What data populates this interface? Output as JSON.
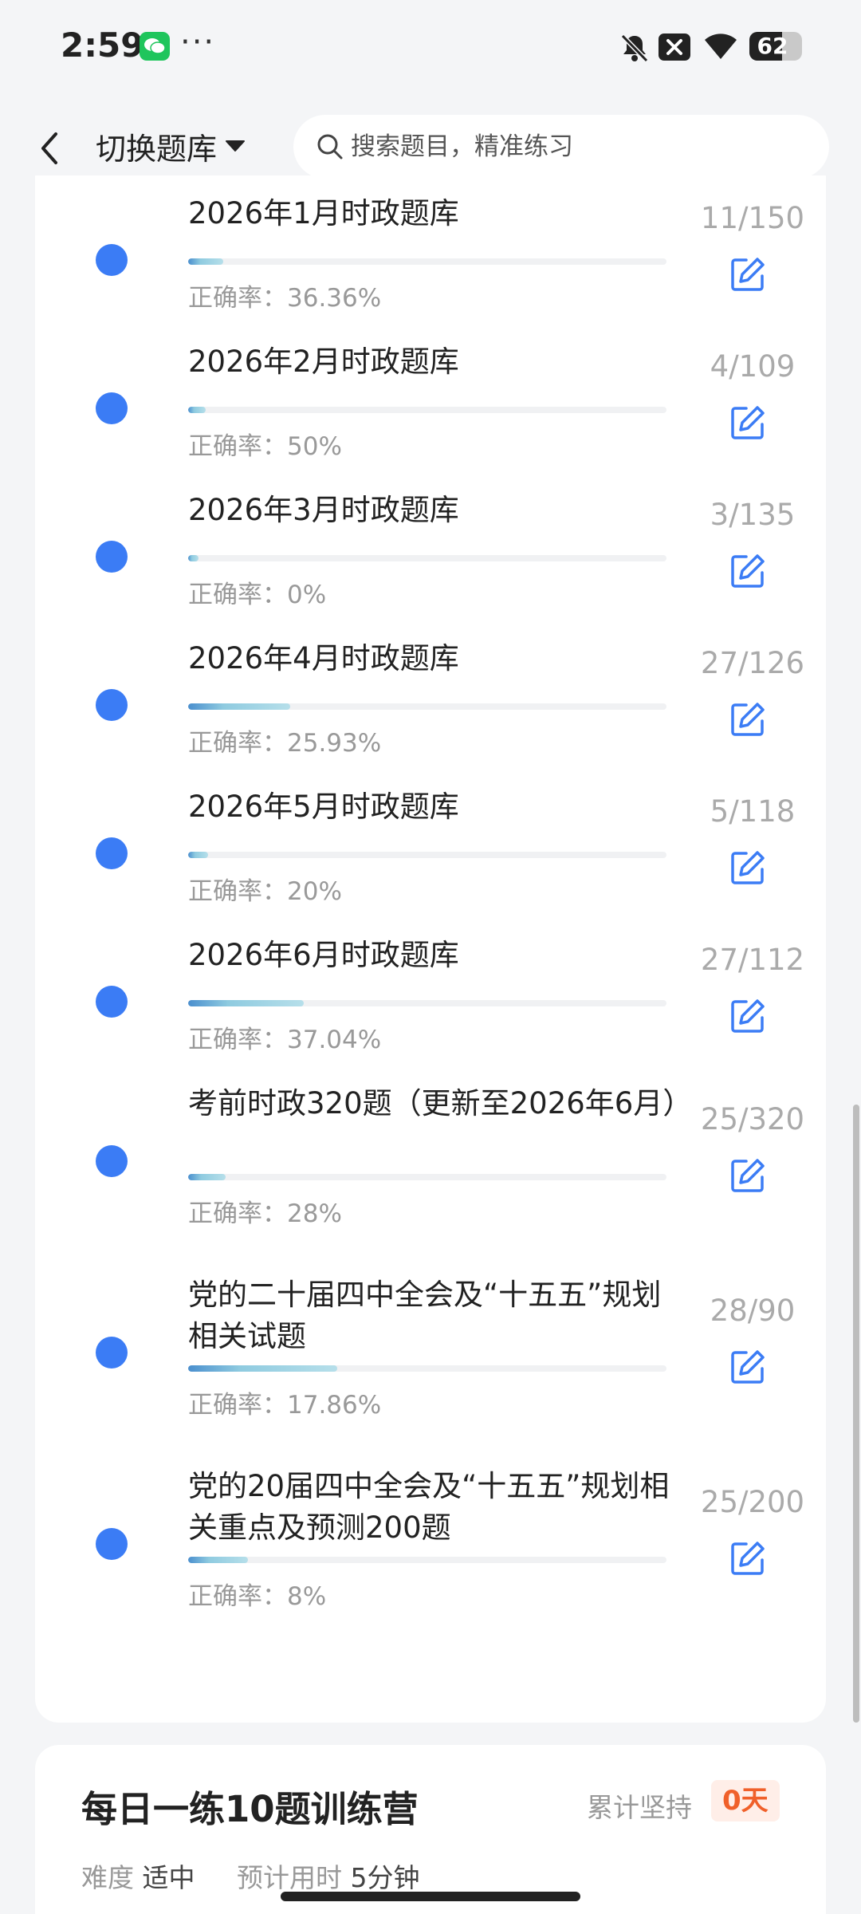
{
  "status_bar": {
    "time": "2:59",
    "more": "···",
    "battery": "62",
    "battery_level": 0.62
  },
  "header": {
    "switch_label": "切换题库",
    "search_placeholder": "搜索题目，精准练习"
  },
  "list": {
    "accuracy_prefix": "正确率：",
    "items": [
      {
        "title": "2026年1月时政题库",
        "accuracy": "36.36%",
        "count": "11/150",
        "progress": 0.073
      },
      {
        "title": "2026年2月时政题库",
        "accuracy": "50%",
        "count": "4/109",
        "progress": 0.037
      },
      {
        "title": "2026年3月时政题库",
        "accuracy": "0%",
        "count": "3/135",
        "progress": 0.022
      },
      {
        "title": "2026年4月时政题库",
        "accuracy": "25.93%",
        "count": "27/126",
        "progress": 0.214
      },
      {
        "title": "2026年5月时政题库",
        "accuracy": "20%",
        "count": "5/118",
        "progress": 0.042
      },
      {
        "title": "2026年6月时政题库",
        "accuracy": "37.04%",
        "count": "27/112",
        "progress": 0.241
      },
      {
        "title": "考前时政320题（更新至2026年6月）",
        "accuracy": "28%",
        "count": "25/320",
        "progress": 0.078
      },
      {
        "title": "党的二十届四中全会及“十五五”规划相关试题",
        "accuracy": "17.86%",
        "count": "28/90",
        "progress": 0.311
      },
      {
        "title": "党的20届四中全会及“十五五”规划相关重点及预测200题",
        "accuracy": "8%",
        "count": "25/200",
        "progress": 0.125
      }
    ]
  },
  "camp": {
    "title": "每日一练10题训练营",
    "streak_label": "累计坚持",
    "streak_value": "0天",
    "difficulty_label": "难度",
    "difficulty_value": "适中",
    "time_label": "预计用时",
    "time_value": "5分钟"
  },
  "colors": {
    "accent": "#3b7cf5",
    "streak": "#f0602a"
  }
}
